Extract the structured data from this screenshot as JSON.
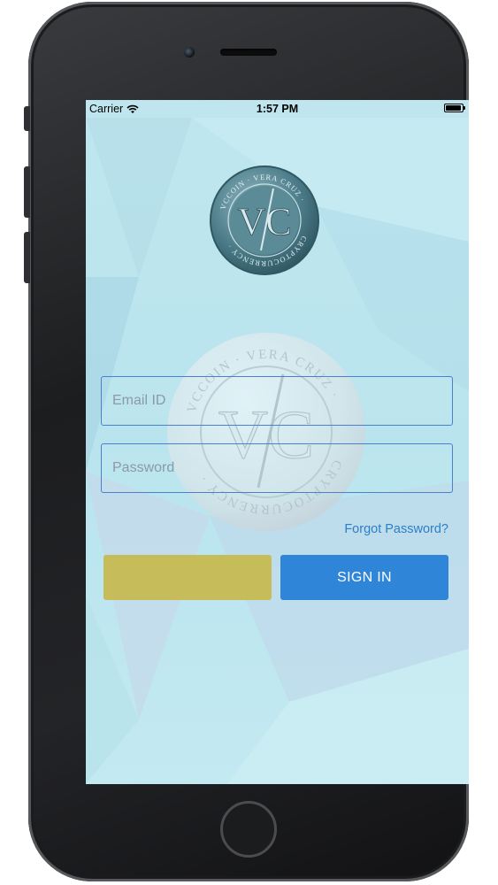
{
  "status_bar": {
    "carrier": "Carrier",
    "time": "1:57 PM",
    "icons": [
      "wifi-icon",
      "battery-icon"
    ]
  },
  "logo": {
    "top_text": "VCCOIN · VERA CRUZ ·",
    "bottom_text": "CRYPTOCURRENCY ·",
    "monogram": "VC"
  },
  "login": {
    "email_placeholder": "Email ID",
    "email_value": "",
    "password_placeholder": "Password",
    "password_value": "",
    "forgot_label": "Forgot Password?",
    "left_button_label": "",
    "signin_label": "SIGN IN"
  },
  "colors": {
    "screen_bg": "#bfe6ef",
    "field_border": "#4a7fd1",
    "signin_button": "#2f86d8",
    "left_button": "#c7bc5a",
    "link": "#2c7fc4"
  }
}
